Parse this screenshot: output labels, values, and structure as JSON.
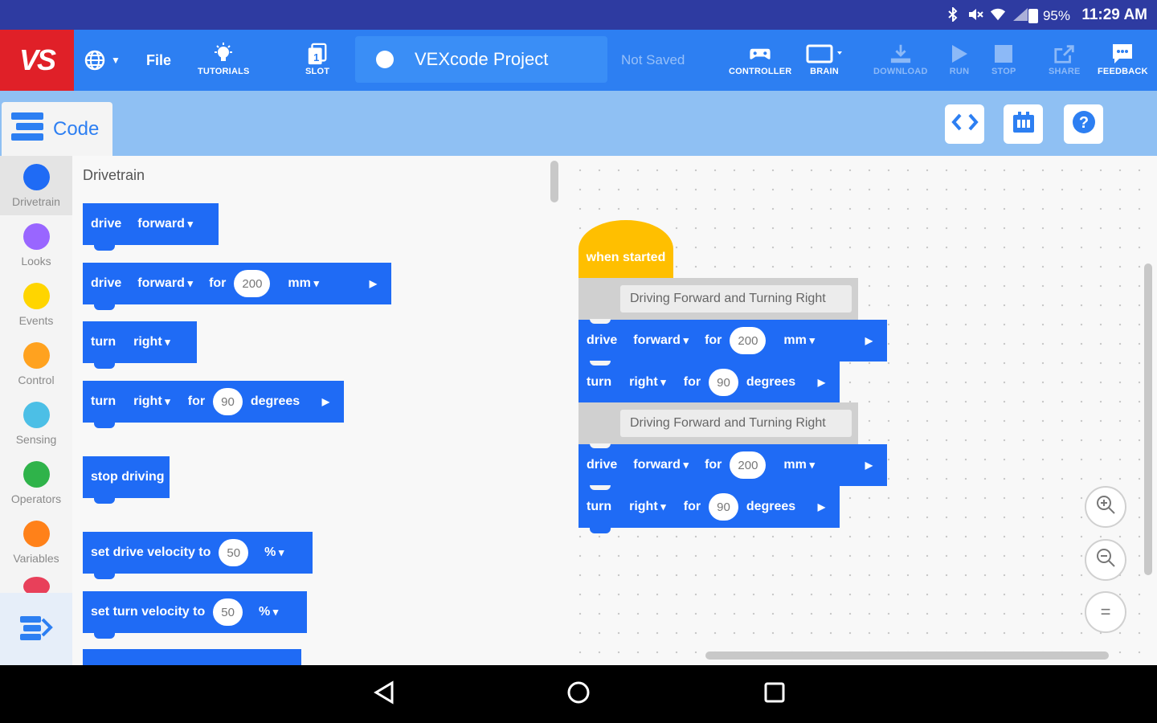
{
  "status_bar": {
    "battery": "95%",
    "time": "11:29 AM",
    "icons": [
      "bluetooth-icon",
      "mute-icon",
      "wifi-icon",
      "signal-icon",
      "battery-icon"
    ]
  },
  "toolbar": {
    "logo": "VS",
    "file_label": "File",
    "tutorials_label": "TUTORIALS",
    "slot_label": "SLOT",
    "slot_number": "1",
    "project_name": "VEXcode Project",
    "save_status": "Not Saved",
    "controller_label": "CONTROLLER",
    "brain_label": "BRAIN",
    "download_label": "DOWNLOAD",
    "run_label": "RUN",
    "stop_label": "STOP",
    "share_label": "SHARE",
    "feedback_label": "FEEDBACK",
    "accent": "#2d7ff2",
    "logo_color": "#e02028"
  },
  "code_tab": {
    "label": "Code"
  },
  "categories": [
    {
      "name": "Drivetrain",
      "color": "#1f6bf5"
    },
    {
      "name": "Looks",
      "color": "#9966ff"
    },
    {
      "name": "Events",
      "color": "#ffd500"
    },
    {
      "name": "Control",
      "color": "#ffa21f"
    },
    {
      "name": "Sensing",
      "color": "#4cbfe6"
    },
    {
      "name": "Operators",
      "color": "#2fb34a"
    },
    {
      "name": "Variables",
      "color": "#ff8119"
    }
  ],
  "flyout": {
    "title": "Drivetrain",
    "b1": {
      "drive": "drive",
      "dir": "forward"
    },
    "b2": {
      "drive": "drive",
      "dir": "forward",
      "for": "for",
      "amount": "200",
      "unit": "mm"
    },
    "b3": {
      "turn": "turn",
      "dir": "right"
    },
    "b4": {
      "turn": "turn",
      "dir": "right",
      "for": "for",
      "amount": "90",
      "unit": "degrees"
    },
    "b5": {
      "label": "stop driving"
    },
    "b6": {
      "label": "set drive velocity to",
      "amount": "50",
      "unit": "%"
    },
    "b7": {
      "label": "set turn velocity to",
      "amount": "50",
      "unit": "%"
    }
  },
  "workspace": {
    "hat": "when started",
    "comment1": "Driving Forward and Turning Right",
    "drive1": {
      "drive": "drive",
      "dir": "forward",
      "for": "for",
      "amount": "200",
      "unit": "mm"
    },
    "turn1": {
      "turn": "turn",
      "dir": "right",
      "for": "for",
      "amount": "90",
      "unit": "degrees"
    },
    "comment2": "Driving Forward and Turning Right",
    "drive2": {
      "drive": "drive",
      "dir": "forward",
      "for": "for",
      "amount": "200",
      "unit": "mm"
    },
    "turn2": {
      "turn": "turn",
      "dir": "right",
      "for": "for",
      "amount": "90",
      "unit": "degrees"
    },
    "zoom_reset": "="
  }
}
